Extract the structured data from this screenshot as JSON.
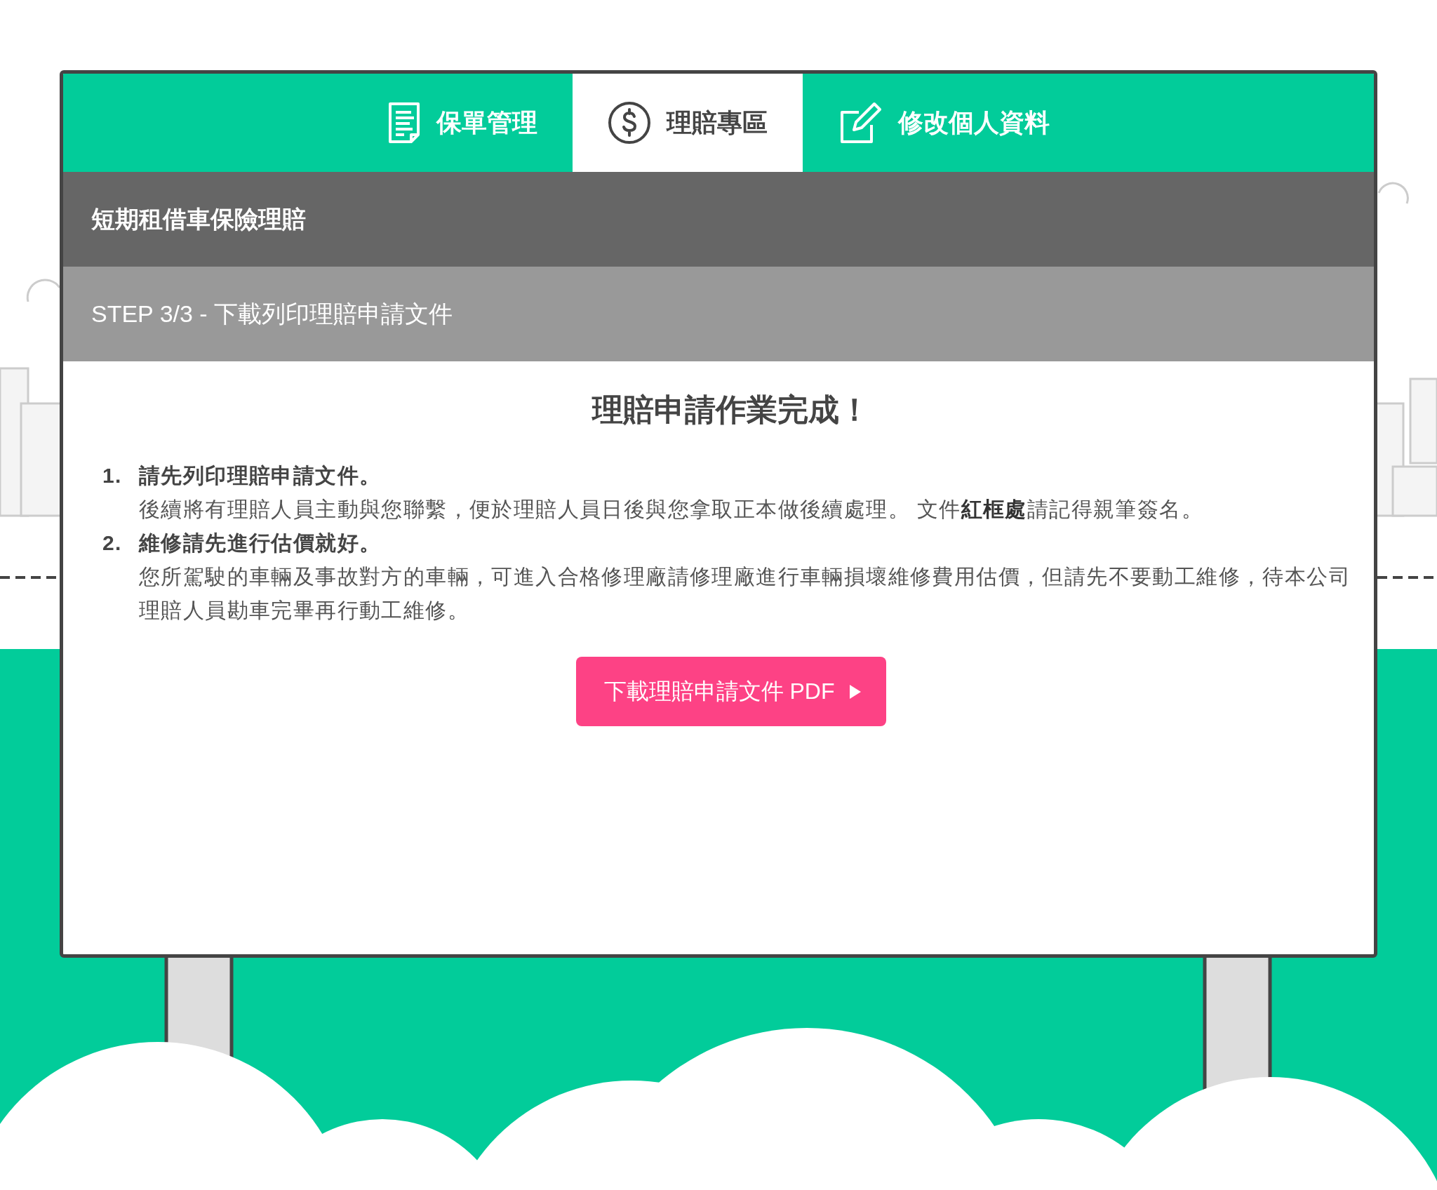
{
  "tabs": [
    {
      "label": "保單管理",
      "kind": "document",
      "selected": false
    },
    {
      "label": "理賠專區",
      "kind": "dollar",
      "selected": true
    },
    {
      "label": "修改個人資料",
      "kind": "edit",
      "selected": false
    }
  ],
  "section_title": "短期租借車保險理賠",
  "step_title": "STEP 3/3 - 下載列印理賠申請文件",
  "heading": "理賠申請作業完成！",
  "steps": [
    {
      "number": "1.",
      "title": "請先列印理賠申請文件。",
      "detail": "後續將有理賠人員主動與您聯繫，便於理賠人員日後與您拿取正本做後續處理。 文件**紅框處**請記得親筆簽名。"
    },
    {
      "number": "2.",
      "title": "維修請先進行估價就好。",
      "detail": "您所駕駛的車輛及事故對方的車輛，可進入合格修理廠請修理廠進行車輛損壞維修費用估價，但請先不要動工維修，待本公司理賠人員勘車完畢再行動工維修。"
    }
  ],
  "download_button": {
    "label": "下載理賠申請文件 PDF"
  }
}
